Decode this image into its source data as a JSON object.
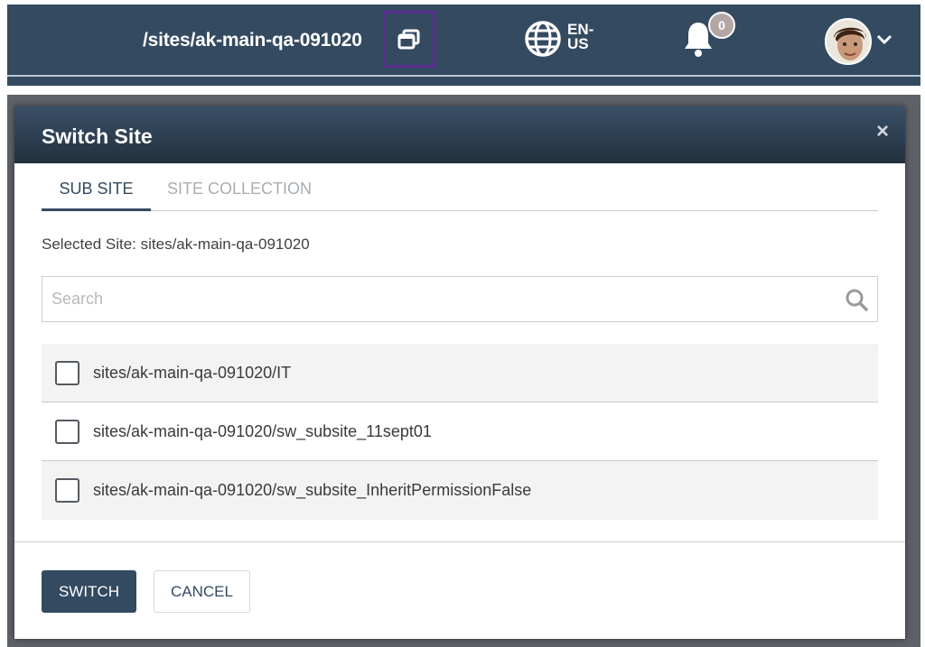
{
  "header": {
    "site_path": "/sites/ak-main-qa-091020",
    "site_switch_icon": "window-restore-icon",
    "language": {
      "icon": "globe-icon",
      "line1": "EN-",
      "line2": "US"
    },
    "notifications": {
      "icon": "bell-icon",
      "count": "0"
    },
    "user": {
      "icon": "avatar",
      "menu_icon": "chevron-down-icon"
    },
    "colors": {
      "bar": "#344a61",
      "highlight_border": "#5c2d91"
    }
  },
  "dialog": {
    "title": "Switch Site",
    "close_label": "×",
    "tabs": [
      {
        "label": "SUB SITE",
        "active": true
      },
      {
        "label": "SITE COLLECTION",
        "active": false
      }
    ],
    "selected_site": "Selected Site: sites/ak-main-qa-091020",
    "search": {
      "placeholder": "Search",
      "value": "",
      "icon": "search-icon"
    },
    "sites": [
      {
        "label": "sites/ak-main-qa-091020/IT",
        "checked": false
      },
      {
        "label": "sites/ak-main-qa-091020/sw_subsite_11sept01",
        "checked": false
      },
      {
        "label": "sites/ak-main-qa-091020/sw_subsite_InheritPermissionFalse",
        "checked": false
      }
    ],
    "buttons": {
      "primary": "SWITCH",
      "secondary": "CANCEL"
    },
    "colors": {
      "primary": "#344a61",
      "inactive_tab": "#a8adb3"
    }
  }
}
